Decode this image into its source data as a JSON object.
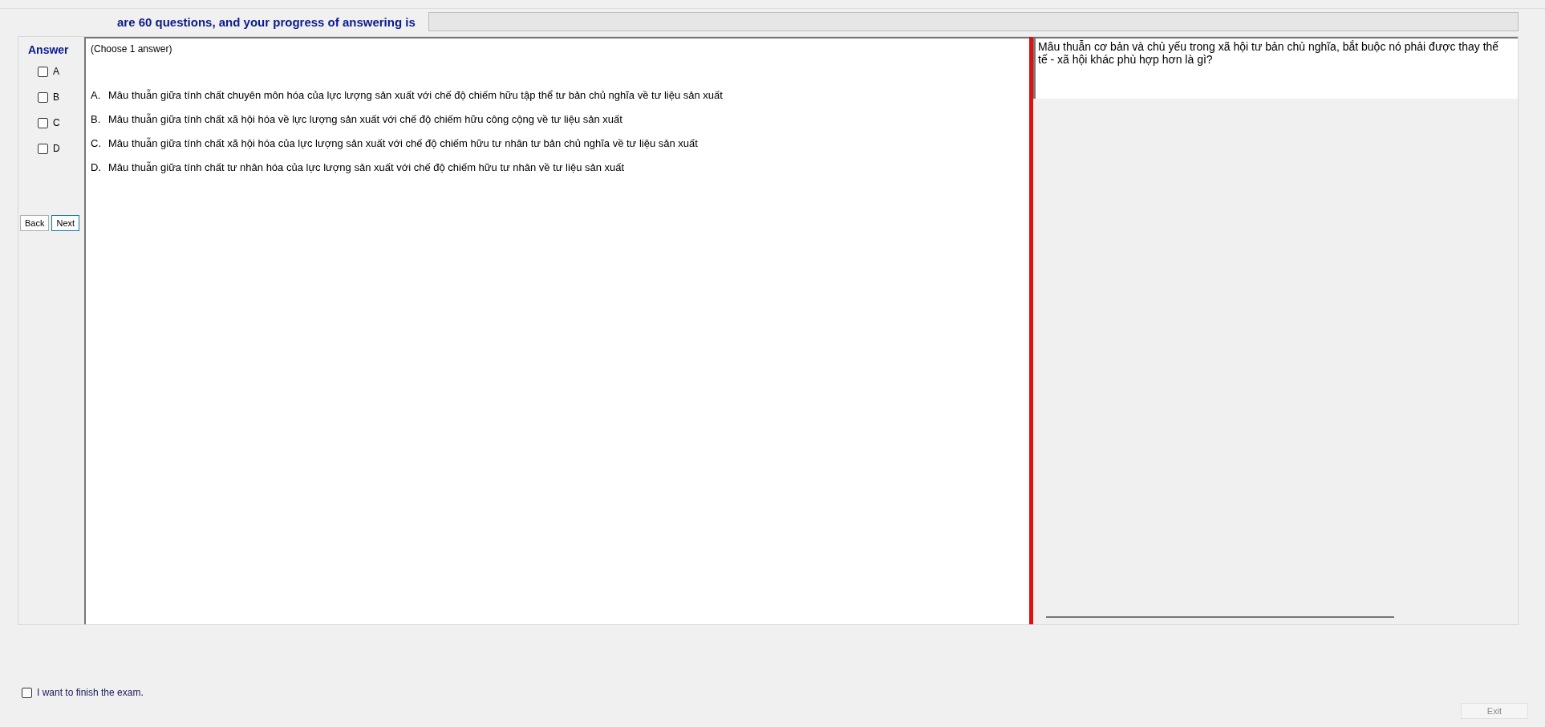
{
  "header": {
    "text": "are 60 questions, and your progress of answering is",
    "progress": {
      "level": 0
    }
  },
  "answer_panel": {
    "title": "Answer",
    "options": [
      {
        "label": "A",
        "checked": false
      },
      {
        "label": "B",
        "checked": false
      },
      {
        "label": "C",
        "checked": false
      },
      {
        "label": "D",
        "checked": false
      }
    ],
    "buttons": [
      {
        "label": "Back",
        "focused": false
      },
      {
        "label": "Next",
        "focused": true
      }
    ]
  },
  "question": {
    "instruction": "(Choose 1 answer)",
    "choices": [
      {
        "letter": "A.",
        "text": "Mâu thuẫn giữa tính chất chuyên môn hóa của lực lượng sản xuất với chế độ chiếm hữu tập thể tư bản chủ nghĩa về tư liệu sản xuất"
      },
      {
        "letter": "B.",
        "text": "Mâu thuẫn giữa tính chất xã hội hóa về lực lượng sản xuất với chế độ chiếm hữu công cộng về tư liệu sản xuất"
      },
      {
        "letter": "C.",
        "text": "Mâu thuẫn giữa tính chất xã hội hóa của lực lượng sản xuất với chế độ chiếm hữu tư nhân tư bản chủ nghĩa về tư liệu sản xuất"
      },
      {
        "letter": "D.",
        "text": "Mâu thuẫn giữa tính chất tư nhân hóa của lực lượng sản xuất với chế độ chiếm hữu tư nhân về tư liệu sản xuất"
      }
    ]
  },
  "question_text": [
    "Mâu thuẫn cơ bản và chủ yếu trong xã hội tư bản chủ nghĩa, bắt buộc nó phải được thay thế",
    "tế - xã hội khác phù hợp hơn là gì?"
  ],
  "finish": {
    "label": "I want to finish the exam.",
    "checked": false
  },
  "exit_button": {
    "label": "Exit",
    "disabled": true
  }
}
